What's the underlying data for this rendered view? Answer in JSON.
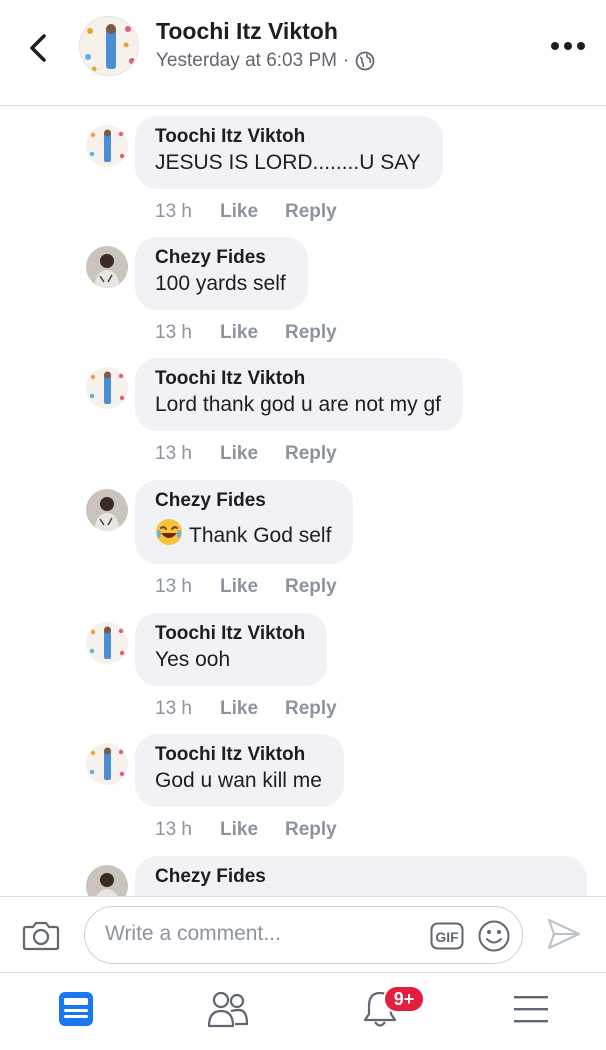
{
  "header": {
    "name": "Toochi Itz Viktoh",
    "timestamp": "Yesterday at 6:03 PM",
    "separator": "·",
    "privacy_icon": "globe-icon"
  },
  "comments": [
    {
      "author": "Toochi Itz Viktoh",
      "text": "JESUS IS LORD........U SAY",
      "time": "13 h",
      "like": "Like",
      "reply": "Reply"
    },
    {
      "author": "Chezy Fides",
      "text": "100 yards self",
      "time": "13 h",
      "like": "Like",
      "reply": "Reply"
    },
    {
      "author": "Toochi Itz Viktoh",
      "text": "Lord thank god u are not my gf",
      "time": "13 h",
      "like": "Like",
      "reply": "Reply"
    },
    {
      "author": "Chezy Fides",
      "text": "Thank God self",
      "emoji": "laughing-tears-emoji",
      "time": "13 h",
      "like": "Like",
      "reply": "Reply"
    },
    {
      "author": "Toochi Itz Viktoh",
      "text": "Yes ooh",
      "time": "13 h",
      "like": "Like",
      "reply": "Reply"
    },
    {
      "author": "Toochi Itz Viktoh",
      "text": "God u wan kill me",
      "time": "13 h",
      "like": "Like",
      "reply": "Reply"
    },
    {
      "author": "Chezy Fides",
      "text": ""
    }
  ],
  "composer": {
    "placeholder": "Write a comment...",
    "gif_label": "GIF"
  },
  "tabbar": {
    "notifications_badge": "9+"
  },
  "colors": {
    "accent": "#1877f2",
    "bubble": "#f0f2f5",
    "badge": "#e41e3f",
    "muted": "#8d949e"
  }
}
